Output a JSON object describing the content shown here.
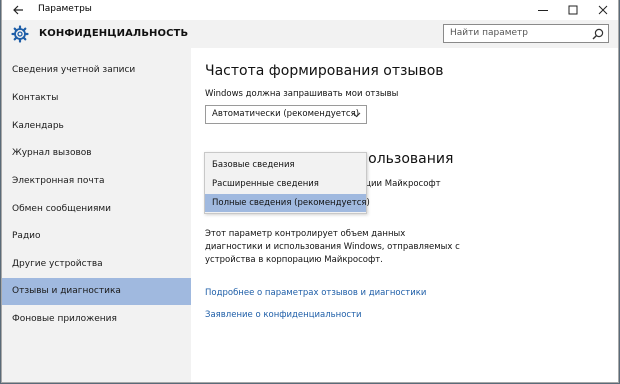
{
  "window": {
    "app_title": "Параметры",
    "back_icon": "back-arrow-icon",
    "controls": [
      "minimize-icon",
      "maximize-icon",
      "close-icon"
    ]
  },
  "header": {
    "icon": "gear-icon",
    "title": "КОНФИДЕНЦИАЛЬНОСТЬ",
    "search_placeholder": "Найти параметр"
  },
  "sidebar": {
    "selected_index": 8,
    "items": [
      {
        "label": "Сведения учетной записи"
      },
      {
        "label": "Контакты"
      },
      {
        "label": "Календарь"
      },
      {
        "label": "Журнал вызовов"
      },
      {
        "label": "Электронная почта"
      },
      {
        "label": "Обмен сообщениями"
      },
      {
        "label": "Радио"
      },
      {
        "label": "Другие устройства"
      },
      {
        "label": "Отзывы и диагностика"
      },
      {
        "label": "Фоновые приложения"
      }
    ]
  },
  "main": {
    "feedback_title": "Частота формирования отзывов",
    "feedback_label": "Windows должна запрашивать мои отзывы",
    "feedback_value": "Автоматически (рекомендуется)",
    "diagnostics_title_partial": "пользования",
    "diagnostics_label_partial": "ации Майкрософт",
    "diagnostics_popup": {
      "options": [
        "Базовые сведения",
        "Расширенные сведения",
        "Полные сведения (рекомендуется)"
      ],
      "selected_index": 2
    },
    "description": "Этот параметр контролирует объем данных диагностики и использования Windows, отправляемых с устройства в корпорацию Майкрософт.",
    "link_more": "Подробнее о параметрах отзывов и диагностики",
    "link_privacy": "Заявление о конфиденциальности"
  },
  "colors": {
    "selection": "#a0b9df",
    "link": "#1e5ea8",
    "sidebar_bg": "#f2f2f2"
  }
}
